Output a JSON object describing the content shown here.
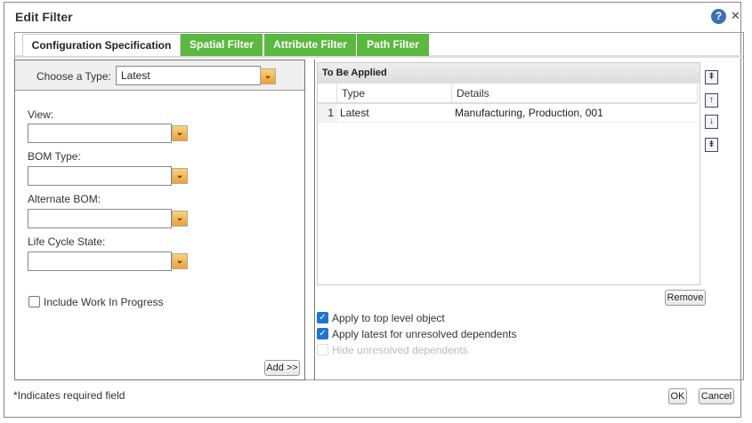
{
  "dialog": {
    "title": "Edit Filter"
  },
  "tabs": [
    {
      "label": "Configuration Specification"
    },
    {
      "label": "Spatial Filter"
    },
    {
      "label": "Attribute Filter"
    },
    {
      "label": "Path Filter"
    }
  ],
  "left": {
    "choose_type_label": "Choose a Type:",
    "choose_type_value": "Latest",
    "fields": [
      {
        "label": "View:",
        "value": ""
      },
      {
        "label": "BOM Type:",
        "value": ""
      },
      {
        "label": "Alternate BOM:",
        "value": ""
      },
      {
        "label": "Life Cycle State:",
        "value": ""
      }
    ],
    "include_wip": "Include Work In Progress",
    "add_label": "Add >>"
  },
  "right": {
    "grid_title": "To Be Applied",
    "columns": [
      "Type",
      "Details"
    ],
    "rows": [
      {
        "num": "1",
        "type": "Latest",
        "details": "Manufacturing, Production, 001"
      }
    ],
    "remove_label": "Remove",
    "options": [
      {
        "label": "Apply to top level object",
        "checked": true
      },
      {
        "label": "Apply latest for unresolved dependents",
        "checked": true
      },
      {
        "label": "Hide unresolved dependents",
        "checked": false,
        "disabled": true
      }
    ]
  },
  "footer": {
    "required_note": "*Indicates required field",
    "ok_label": "OK",
    "cancel_label": "Cancel"
  }
}
